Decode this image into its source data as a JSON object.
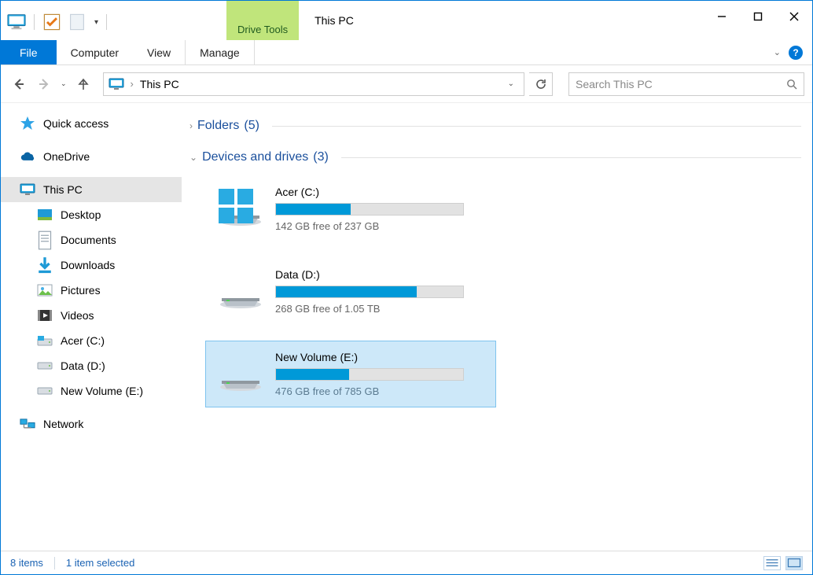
{
  "window": {
    "title": "This PC",
    "drive_tools_label": "Drive Tools"
  },
  "tabs": {
    "file": "File",
    "computer": "Computer",
    "view": "View",
    "manage": "Manage"
  },
  "navbar": {
    "breadcrumb_sep": "›",
    "breadcrumb_current": "This PC"
  },
  "search": {
    "placeholder": "Search This PC"
  },
  "sidebar": {
    "quick_access": "Quick access",
    "onedrive": "OneDrive",
    "this_pc": "This PC",
    "desktop": "Desktop",
    "documents": "Documents",
    "downloads": "Downloads",
    "pictures": "Pictures",
    "videos": "Videos",
    "acer": "Acer (C:)",
    "data": "Data (D:)",
    "newvol": "New Volume (E:)",
    "network": "Network"
  },
  "sections": {
    "folders": {
      "label": "Folders",
      "count": "(5)"
    },
    "drives": {
      "label": "Devices and drives",
      "count": "(3)"
    }
  },
  "drives": [
    {
      "name": "Acer (C:)",
      "free_text": "142 GB free of 237 GB",
      "fill_pct": 40,
      "win_logo": true,
      "selected": false
    },
    {
      "name": "Data (D:)",
      "free_text": "268 GB free of 1.05 TB",
      "fill_pct": 75,
      "win_logo": false,
      "selected": false
    },
    {
      "name": "New Volume (E:)",
      "free_text": "476 GB free of 785 GB",
      "fill_pct": 39,
      "win_logo": false,
      "selected": true
    }
  ],
  "statusbar": {
    "items": "8 items",
    "selected": "1 item selected"
  }
}
